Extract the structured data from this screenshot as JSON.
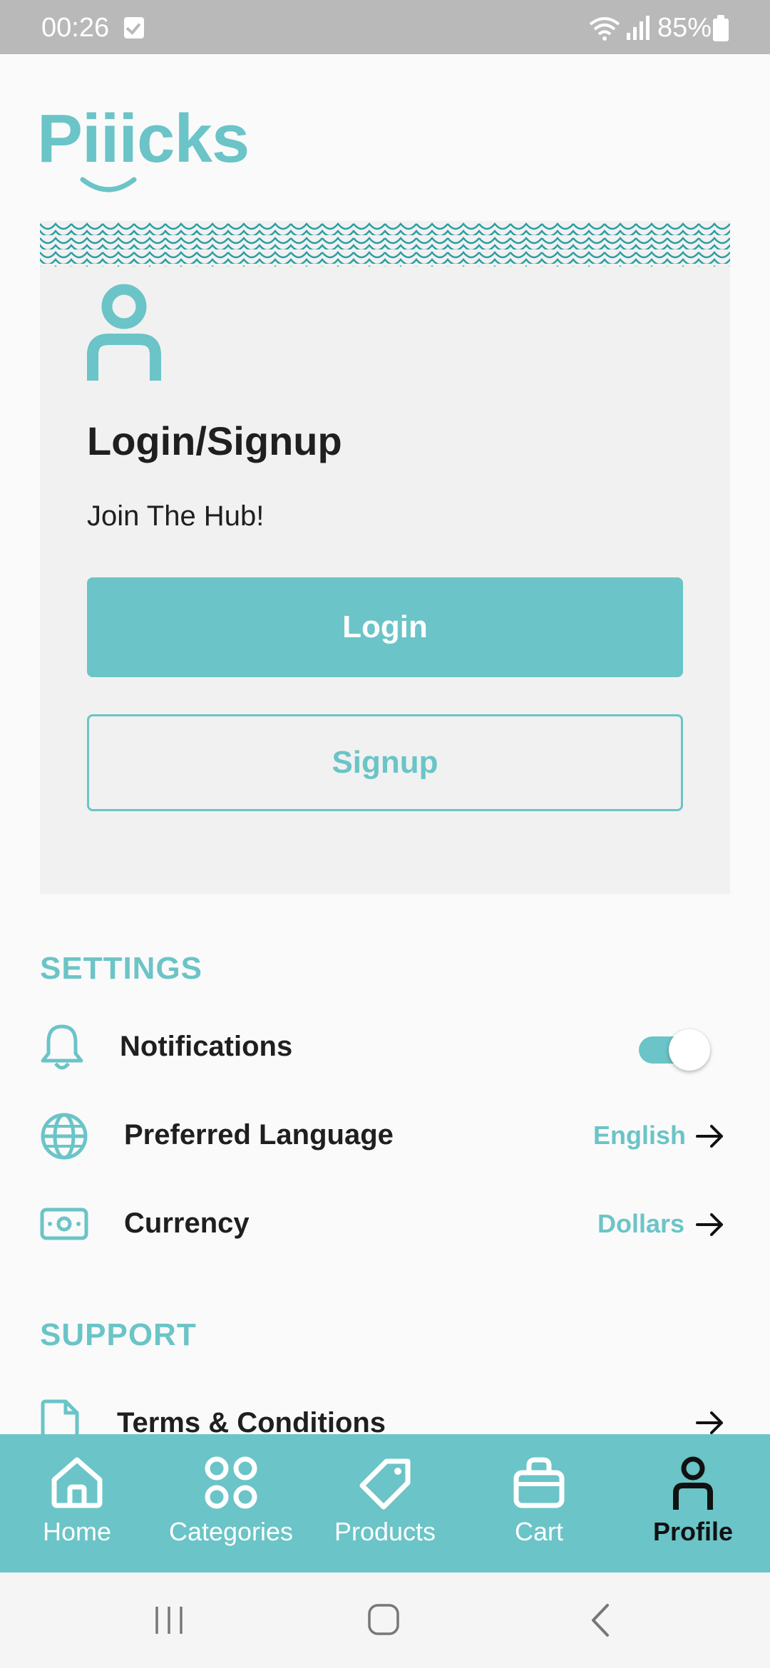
{
  "status_bar": {
    "time": "00:26",
    "battery": "85%"
  },
  "app": {
    "logo_text": "Piiicks",
    "brand_color": "#6bc4c7"
  },
  "login_card": {
    "title": "Login/Signup",
    "subtitle": "Join The Hub!",
    "login_label": "Login",
    "signup_label": "Signup"
  },
  "settings": {
    "title": "SETTINGS",
    "notifications_label": "Notifications",
    "notifications_enabled": true,
    "language_label": "Preferred Language",
    "language_value": "English",
    "currency_label": "Currency",
    "currency_value": "Dollars"
  },
  "support": {
    "title": "SUPPORT",
    "terms_label": "Terms & Conditions"
  },
  "bottom_nav": {
    "items": [
      {
        "label": "Home",
        "icon": "home-icon"
      },
      {
        "label": "Categories",
        "icon": "categories-icon"
      },
      {
        "label": "Products",
        "icon": "tag-icon"
      },
      {
        "label": "Cart",
        "icon": "bag-icon"
      },
      {
        "label": "Profile",
        "icon": "profile-icon"
      }
    ],
    "active": "Profile"
  }
}
